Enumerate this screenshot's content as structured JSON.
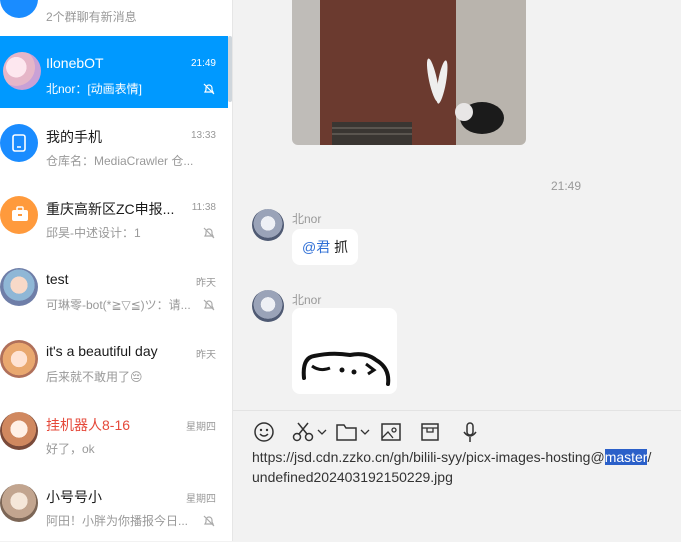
{
  "chats": [
    {
      "name": "",
      "preview": "2个群聊有新消息",
      "time": "",
      "muted": false
    },
    {
      "name": "IlonebOT",
      "preview": "北nor：[动画表情]",
      "time": "21:49",
      "muted": true
    },
    {
      "name": "我的手机",
      "preview": "仓库名：MediaCrawler 仓...",
      "time": "13:33",
      "muted": false
    },
    {
      "name": "重庆高新区ZC申报...",
      "preview": "邱昊-中述设计：1",
      "time": "11:38",
      "muted": true
    },
    {
      "name": "test",
      "preview": "可琳零-bot(*≧▽≦)ツ：请...",
      "time": "昨天",
      "muted": true
    },
    {
      "name": "it's a beautiful day",
      "preview": "后来就不敢用了😔",
      "time": "昨天",
      "muted": false
    },
    {
      "name": "挂机器人8-16",
      "preview": "好了，ok",
      "time": "星期四",
      "muted": false
    },
    {
      "name": "小号号小",
      "preview": "阿田！小胖为你播报今日...",
      "time": "星期四",
      "muted": true
    }
  ],
  "conversation": {
    "timestamp": "21:49",
    "messages": [
      {
        "sender": "北nor",
        "mention": "@君",
        "text": " 抓"
      },
      {
        "sender": "北nor",
        "type": "sticker"
      }
    ]
  },
  "input": {
    "before": "https://jsd.cdn.zzko.cn/gh/bilili-syy/picx-images-hosting@",
    "selected": "master",
    "after": "/undefined202403192150229.jpg"
  },
  "toolbar": [
    "emoji-icon",
    "scissors-icon",
    "folder-icon",
    "screenshot-image-icon",
    "box-icon",
    "microphone-icon"
  ],
  "colors": {
    "accent": "#0099ff",
    "selection": "#2b60c9",
    "group-red": "#e5493a"
  }
}
